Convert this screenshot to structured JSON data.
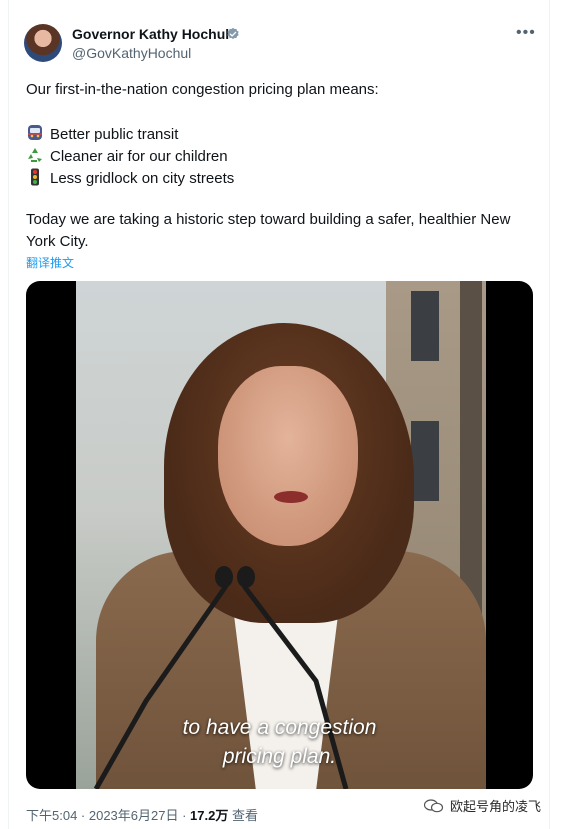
{
  "author": {
    "name": "Governor Kathy Hochul",
    "handle": "@GovKathyHochul"
  },
  "tweet": {
    "intro": "Our first-in-the-nation congestion pricing plan means:",
    "bullets": [
      {
        "icon": "metro-icon",
        "text": "Better public transit"
      },
      {
        "icon": "recycle-icon",
        "text": "Cleaner air for our children"
      },
      {
        "icon": "traffic-light-icon",
        "text": "Less gridlock on city streets"
      }
    ],
    "closing_line1": "Today we are taking a historic step toward building a safer, healthier New",
    "closing_line2": "York City.",
    "translate_label": "翻译推文"
  },
  "video": {
    "subtitle_line1": "to have a congestion",
    "subtitle_line2": "pricing plan."
  },
  "meta": {
    "time_date": "下午5:04 · 2023年6月27日 · ",
    "views_count": "17.2万",
    "views_label": " 查看"
  },
  "watermark": {
    "text": "欧起号角的凌飞"
  },
  "colors": {
    "link": "#1d9bf0",
    "secondary_text": "#536471",
    "verified": "#829aab"
  }
}
